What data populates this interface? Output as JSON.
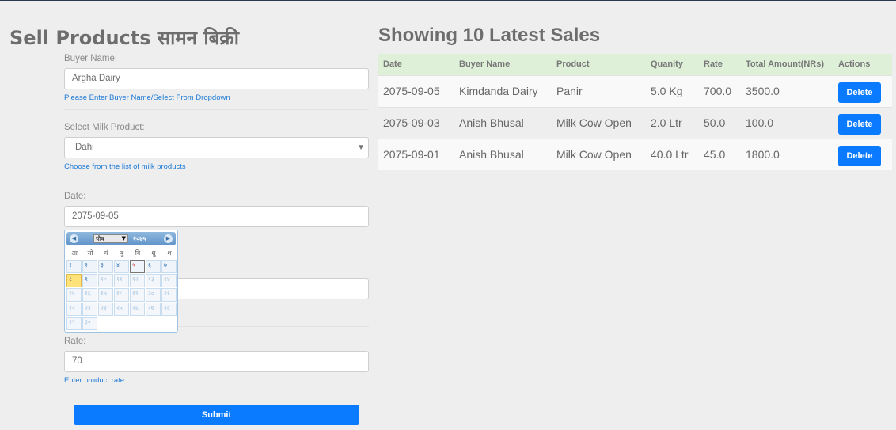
{
  "form": {
    "title": "Sell Products सामन बिक्री",
    "buyer": {
      "label": "Buyer Name:",
      "value": "Argha Dairy",
      "help": "Please Enter Buyer Name/Select From Dropdown"
    },
    "product": {
      "label": "Select Milk Product:",
      "value": "Dahi",
      "help": "Choose from the list of milk products"
    },
    "date": {
      "label": "Date:",
      "value": "2075-09-05"
    },
    "rate": {
      "label": "Rate:",
      "value": "70",
      "help": "Enter product rate"
    },
    "submit_label": "Submit"
  },
  "calendar": {
    "month": "पौष",
    "year": "२०७५",
    "weekdays": [
      "आ",
      "सो",
      "मं",
      "बु",
      "बि",
      "शु",
      "श"
    ],
    "days_row1": [
      "१",
      "२",
      "३",
      "४",
      "५",
      "६",
      "७"
    ],
    "days_row2": [
      "८",
      "९",
      "१०",
      "११",
      "१२",
      "१३",
      "१४"
    ],
    "days_row3": [
      "१५",
      "१६",
      "१७",
      "१८",
      "१९",
      "२०",
      "२१"
    ],
    "days_row4": [
      "२२",
      "२३",
      "२४",
      "२५",
      "२६",
      "२७",
      "२८"
    ],
    "days_row5": [
      "२९",
      "३०"
    ]
  },
  "sales": {
    "title": "Showing 10 Latest Sales",
    "headers": [
      "Date",
      "Buyer Name",
      "Product",
      "Quanity",
      "Rate",
      "Total Amount(NRs)",
      "Actions"
    ],
    "rows": [
      {
        "date": "2075-09-05",
        "buyer": "Kimdanda Dairy",
        "product": "Panir",
        "quantity": "5.0 Kg",
        "rate": "700.0",
        "total": "3500.0",
        "action": "Delete"
      },
      {
        "date": "2075-09-03",
        "buyer": "Anish Bhusal",
        "product": "Milk Cow Open",
        "quantity": "2.0 Ltr",
        "rate": "50.0",
        "total": "100.0",
        "action": "Delete"
      },
      {
        "date": "2075-09-01",
        "buyer": "Anish Bhusal",
        "product": "Milk Cow Open",
        "quantity": "40.0 Ltr",
        "rate": "45.0",
        "total": "1800.0",
        "action": "Delete"
      }
    ]
  },
  "colors": {
    "accent": "#0a7bff",
    "table_header_bg": "#dff0d8",
    "help_text": "#1e7ad6",
    "today_highlight": "#ffe37a"
  }
}
